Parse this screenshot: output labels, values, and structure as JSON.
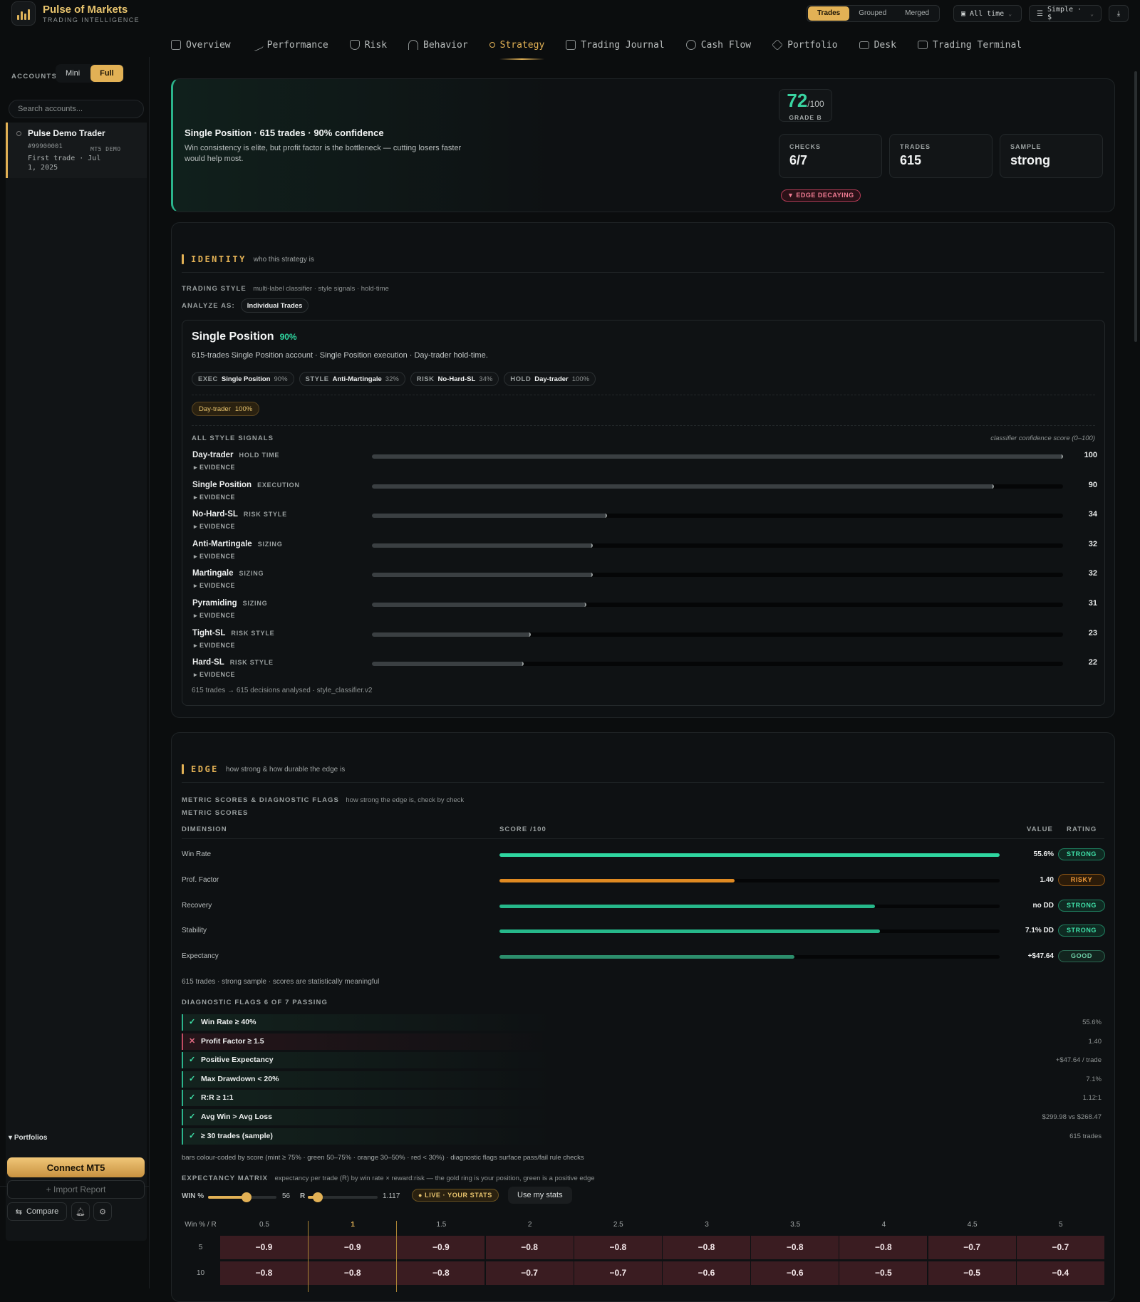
{
  "app": {
    "title": "Pulse of Markets",
    "subtitle": "TRADING INTELLIGENCE"
  },
  "topbar": {
    "view_modes": [
      "Trades",
      "Grouped",
      "Merged"
    ],
    "active_view": "Trades",
    "time_range": "All time",
    "display_mode": "Simple · $"
  },
  "nav": {
    "tabs": [
      {
        "label": "Overview",
        "icon": "grid-icon"
      },
      {
        "label": "Performance",
        "icon": "trend-up-icon"
      },
      {
        "label": "Risk",
        "icon": "shield-icon"
      },
      {
        "label": "Behavior",
        "icon": "gauge-icon"
      },
      {
        "label": "Strategy",
        "icon": "branch-icon"
      },
      {
        "label": "Trading Journal",
        "icon": "book-icon"
      },
      {
        "label": "Cash Flow",
        "icon": "dollar-circle-icon"
      },
      {
        "label": "Portfolio",
        "icon": "layers-icon"
      },
      {
        "label": "Desk",
        "icon": "monitor-icon"
      },
      {
        "label": "Trading Terminal",
        "icon": "terminal-icon"
      }
    ],
    "active": "Strategy"
  },
  "sidebar": {
    "accounts_label": "ACCOUNTS",
    "modes": [
      "Mini",
      "Full"
    ],
    "active_mode": "Full",
    "search_placeholder": "Search accounts...",
    "account": {
      "name": "Pulse Demo Trader",
      "number": "#99900001",
      "type": "MT5 DEMO",
      "first_trade": "First trade · Jul 1, 2025"
    },
    "portfolios_label": "Portfolios",
    "connect_label": "Connect MT5",
    "import_label": "+ Import Report",
    "compare_label": "Compare"
  },
  "hero": {
    "title": "Single Position · 615 trades · 90% confidence",
    "description": "Win consistency is elite, but profit factor is the bottleneck — cutting losers faster would help most.",
    "grade_score": "72",
    "grade_max": "/100",
    "grade_label": "GRADE B",
    "stats": [
      {
        "label": "CHECKS",
        "value": "6/7"
      },
      {
        "label": "TRADES",
        "value": "615"
      },
      {
        "label": "SAMPLE",
        "value": "strong"
      }
    ],
    "badge": "▼ EDGE DECAYING"
  },
  "identity": {
    "title": "IDENTITY",
    "subtitle": "who this strategy is",
    "trading_style_label": "TRADING STYLE",
    "trading_style_desc": "multi-label classifier · style signals · hold-time",
    "analyze_label": "ANALYZE AS:",
    "analyze_value": "Individual Trades",
    "style_name": "Single Position",
    "style_conf": "90%",
    "style_desc": "615-trades Single Position account · Single Position execution · Day-trader hold-time.",
    "chips": [
      {
        "k": "EXEC",
        "v": "Single Position",
        "p": "90%"
      },
      {
        "k": "STYLE",
        "v": "Anti-Martingale",
        "p": "32%"
      },
      {
        "k": "RISK",
        "v": "No-Hard-SL",
        "p": "34%"
      },
      {
        "k": "HOLD",
        "v": "Day-trader",
        "p": "100%"
      }
    ],
    "tag": {
      "name": "Day-trader",
      "pct": "100%"
    },
    "signals_label": "ALL STYLE SIGNALS",
    "signals_note": "classifier confidence score (0–100)",
    "evidence_label": "▸ EVIDENCE",
    "signals": [
      {
        "name": "Day-trader",
        "category": "HOLD TIME",
        "score": 100
      },
      {
        "name": "Single Position",
        "category": "EXECUTION",
        "score": 90
      },
      {
        "name": "No-Hard-SL",
        "category": "RISK STYLE",
        "score": 34
      },
      {
        "name": "Anti-Martingale",
        "category": "SIZING",
        "score": 32
      },
      {
        "name": "Martingale",
        "category": "SIZING",
        "score": 32
      },
      {
        "name": "Pyramiding",
        "category": "SIZING",
        "score": 31
      },
      {
        "name": "Tight-SL",
        "category": "RISK STYLE",
        "score": 23
      },
      {
        "name": "Hard-SL",
        "category": "RISK STYLE",
        "score": 22
      }
    ],
    "footer": "615 trades → 615 decisions analysed · style_classifier.v2"
  },
  "edge": {
    "title": "EDGE",
    "subtitle": "how strong & how durable the edge is",
    "metrics_label": "METRIC SCORES & DIAGNOSTIC FLAGS",
    "metrics_desc": "how strong the edge is, check by check",
    "scores_label": "METRIC SCORES",
    "col_dimension": "DIMENSION",
    "col_score": "SCORE /100",
    "col_value": "VALUE",
    "col_rating": "RATING",
    "metrics": [
      {
        "name": "Win Rate",
        "score": 100,
        "value": "55.6%",
        "rating": "STRONG",
        "color": "#2fd6a0"
      },
      {
        "name": "Prof. Factor",
        "score": 47,
        "value": "1.40",
        "rating": "RISKY",
        "color": "#e08a22"
      },
      {
        "name": "Recovery",
        "score": 75,
        "value": "no DD",
        "rating": "STRONG",
        "color": "#26b88a"
      },
      {
        "name": "Stability",
        "score": 76,
        "value": "7.1% DD",
        "rating": "STRONG",
        "color": "#26b88a"
      },
      {
        "name": "Expectancy",
        "score": 59,
        "value": "+$47.64",
        "rating": "GOOD",
        "color": "#2c8e6c"
      }
    ],
    "sample_note": "615 trades · strong sample · scores are statistically meaningful",
    "flags_label": "DIAGNOSTIC FLAGS 6 OF 7 PASSING",
    "flags": [
      {
        "name": "Win Rate ≥ 40%",
        "value": "55.6%",
        "pass": true
      },
      {
        "name": "Profit Factor ≥ 1.5",
        "value": "1.40",
        "pass": false
      },
      {
        "name": "Positive Expectancy",
        "value": "+$47.64 / trade",
        "pass": true
      },
      {
        "name": "Max Drawdown < 20%",
        "value": "7.1%",
        "pass": true
      },
      {
        "name": "R:R ≥ 1:1",
        "value": "1.12:1",
        "pass": true
      },
      {
        "name": "Avg Win > Avg Loss",
        "value": "$299.98 vs $268.47",
        "pass": true
      },
      {
        "name": "≥ 30 trades (sample)",
        "value": "615 trades",
        "pass": true
      }
    ],
    "legend_note": "bars colour-coded by score (mint ≥ 75% · green 50–75% · orange 30–50% · red < 30%) · diagnostic flags surface pass/fail rule checks",
    "matrix_label": "EXPECTANCY MATRIX",
    "matrix_desc": "expectancy per trade (R) by win rate × reward:risk — the gold ring is your position, green is a positive edge",
    "win_label": "WIN %",
    "win_value": "56",
    "win_fraction": 0.56,
    "r_label": "R",
    "r_value": "1.117",
    "r_fraction": 0.14,
    "live_badge": "● LIVE · YOUR STATS",
    "use_stats_label": "Use my stats",
    "corner_label": "Win % / R",
    "r_columns": [
      "0.5",
      "1",
      "1.5",
      "2",
      "2.5",
      "3",
      "3.5",
      "4",
      "4.5",
      "5"
    ],
    "rows": [
      {
        "win": "5",
        "cells": [
          "−0.9",
          "−0.9",
          "−0.9",
          "−0.8",
          "−0.8",
          "−0.8",
          "−0.8",
          "−0.8",
          "−0.7",
          "−0.7"
        ]
      },
      {
        "win": "10",
        "cells": [
          "−0.8",
          "−0.8",
          "−0.8",
          "−0.7",
          "−0.7",
          "−0.6",
          "−0.6",
          "−0.5",
          "−0.5",
          "−0.4"
        ]
      }
    ]
  }
}
